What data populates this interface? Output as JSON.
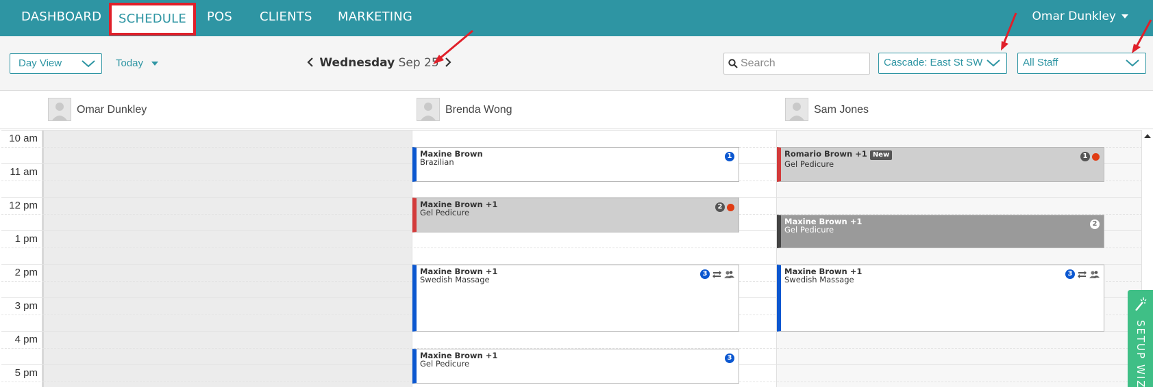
{
  "nav": {
    "items": [
      "DASHBOARD",
      "SCHEDULE",
      "POS",
      "CLIENTS",
      "MARKETING"
    ],
    "active": "SCHEDULE",
    "user": "Omar Dunkley",
    "color": "#2e95a3"
  },
  "toolbar": {
    "view_select": "Day View",
    "today_label": "Today",
    "date_dow": "Wednesday",
    "date": "Sep 25",
    "search_placeholder": "Search",
    "location_select": "Cascade: East St SW",
    "staff_select": "All Staff"
  },
  "staff": [
    "Omar Dunkley",
    "Brenda Wong",
    "Sam Jones"
  ],
  "hours": [
    "10 am",
    "11 am",
    "12 pm",
    "1 pm",
    "2 pm",
    "3 pm",
    "4 pm",
    "5 pm"
  ],
  "appointments": {
    "b1": {
      "client": "Maxine Brown",
      "service": "Brazilian",
      "count": "1"
    },
    "b2": {
      "client": "Maxine Brown +1",
      "service": "Gel Pedicure",
      "count": "2"
    },
    "b3": {
      "client": "Maxine Brown +1",
      "service": "Swedish Massage",
      "count": "3"
    },
    "b4": {
      "client": "Maxine Brown +1",
      "service": "Gel Pedicure",
      "count": "3"
    },
    "s1": {
      "client": "Romario Brown +1",
      "badge": "New",
      "service": "Gel Pedicure",
      "count": "1"
    },
    "s2": {
      "client": "Maxine Brown +1",
      "service": "Gel Pedicure",
      "count": "2"
    },
    "s3": {
      "client": "Maxine Brown +1",
      "service": "Swedish Massage",
      "count": "3"
    }
  },
  "wizard": {
    "label": "SETUP WIZ"
  },
  "icons": [
    "caret-down-icon",
    "chevron-left-icon",
    "chevron-right-icon",
    "search-icon",
    "repeat-icon",
    "group-icon",
    "magic-wand-icon",
    "avatar-placeholder-icon"
  ]
}
